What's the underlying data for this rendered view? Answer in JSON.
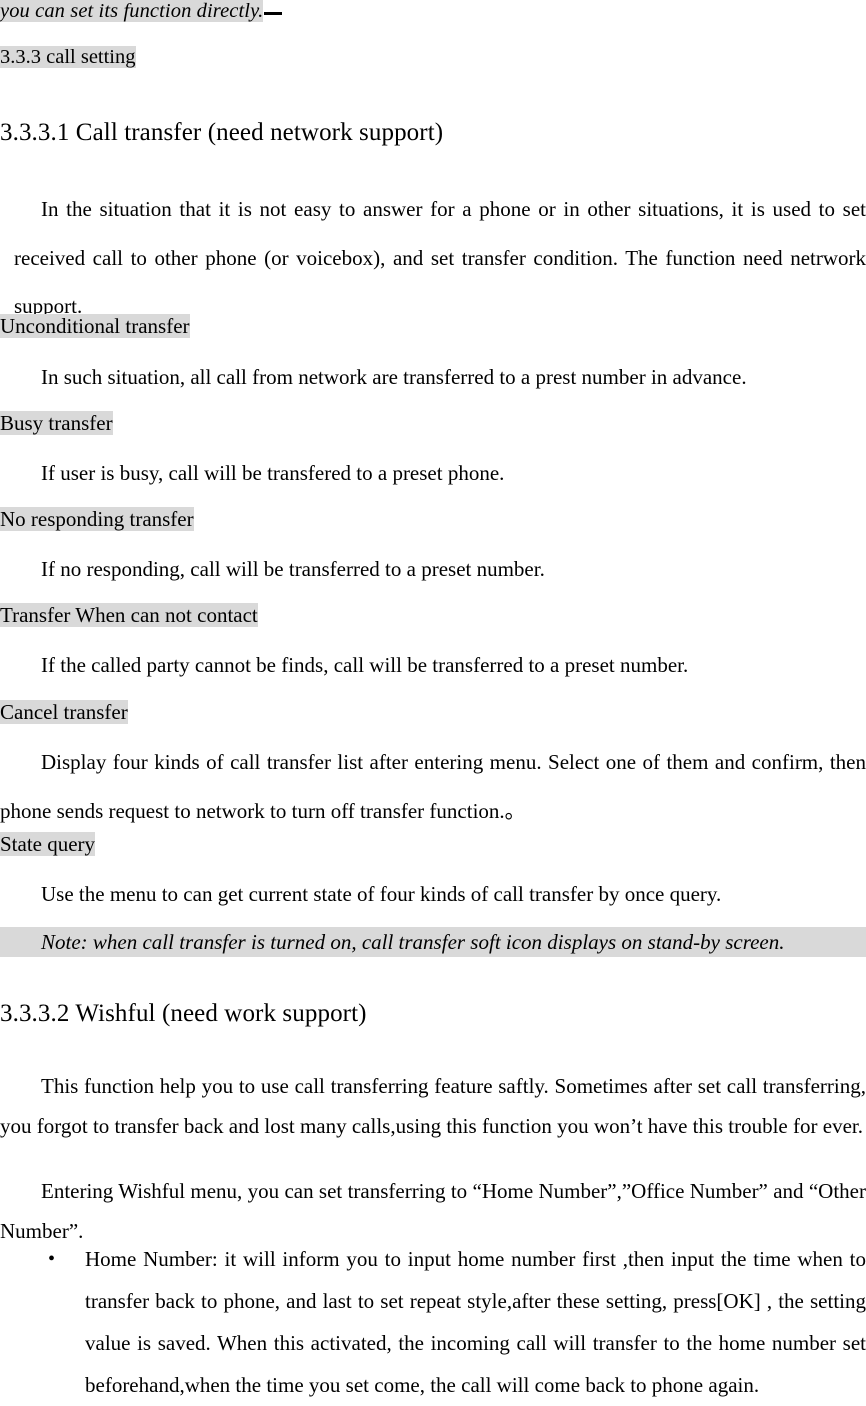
{
  "document": {
    "top_fragment": {
      "text": "you can set its function directly.",
      "trailing_mark": " "
    },
    "section_label": "3.3.3 call setting",
    "headings": {
      "call_transfer": "3.3.3.1 Call transfer (need network support)",
      "wishful": "3.3.3.2 Wishful (need work support)"
    },
    "call_transfer": {
      "intro": "In the situation that it is not easy to answer for a phone or in other situations, it is used to set received call to other phone (or voicebox), and set transfer condition. The function need netrwork support.",
      "items": [
        {
          "title": "Unconditional transfer",
          "body": "In such situation, all call from network are transferred to a prest number in advance."
        },
        {
          "title": "Busy transfer",
          "body": "If user is busy, call will be transfered to a preset phone."
        },
        {
          "title": "No responding transfer",
          "body": "If no responding, call will be transferred to a preset number."
        },
        {
          "title": "Transfer When can not contact",
          "body": "If the called party cannot be finds, call will be transferred to a preset number."
        },
        {
          "title": "Cancel transfer",
          "body": "Display four kinds of call transfer list after entering menu. Select one of them and confirm, then phone sends request to network to turn off transfer function.。"
        },
        {
          "title": "State query",
          "body": "Use the menu to can get current state of four kinds of call transfer by once query."
        }
      ],
      "note": "Note: when call transfer is turned on, call transfer soft icon displays on stand-by screen."
    },
    "wishful": {
      "paragraph_1": "This function help you to use call transferring feature saftly. Sometimes after set call transferring, you forgot to transfer back    and    lost many calls,using this function you won’t have this trouble for ever.",
      "paragraph_2": "Entering Wishful menu, you can set transferring to “Home Number”,”Office Number” and “Other Number”.",
      "bullets": [
        {
          "marker": "•",
          "text": "Home Number: it will inform you to input home number first ,then input the time when to transfer back to phone, and last to set repeat style,after these setting, press[OK] , the setting value is saved. When this activated, the incoming call will transfer to the home number set beforehand,when the time you set come, the call will come back to phone again."
        }
      ]
    }
  },
  "style": {
    "highlight_color": "#d9d9d9",
    "text_color": "#000000",
    "page_background": "#ffffff"
  }
}
